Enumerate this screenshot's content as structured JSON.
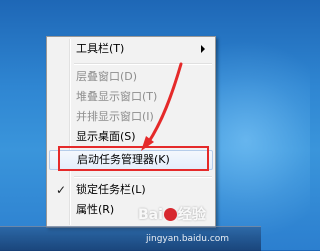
{
  "context_menu": {
    "items": [
      {
        "label": "工具栏(T)",
        "enabled": true,
        "submenu": true
      },
      {
        "label": "层叠窗口(D)",
        "enabled": false
      },
      {
        "label": "堆叠显示窗口(T)",
        "enabled": false
      },
      {
        "label": "并排显示窗口(I)",
        "enabled": false
      },
      {
        "label": "显示桌面(S)",
        "enabled": true
      },
      {
        "label": "启动任务管理器(K)",
        "enabled": true,
        "highlighted": true
      },
      {
        "label": "锁定任务栏(L)",
        "enabled": true,
        "checked": true
      },
      {
        "label": "属性(R)",
        "enabled": true
      }
    ],
    "check_glyph": "✓"
  },
  "annotation": {
    "color": "#e52a2a"
  },
  "watermark": {
    "logo_text_left": "Bai",
    "logo_text_right": "经验",
    "url": "jingyan.baidu.com"
  }
}
